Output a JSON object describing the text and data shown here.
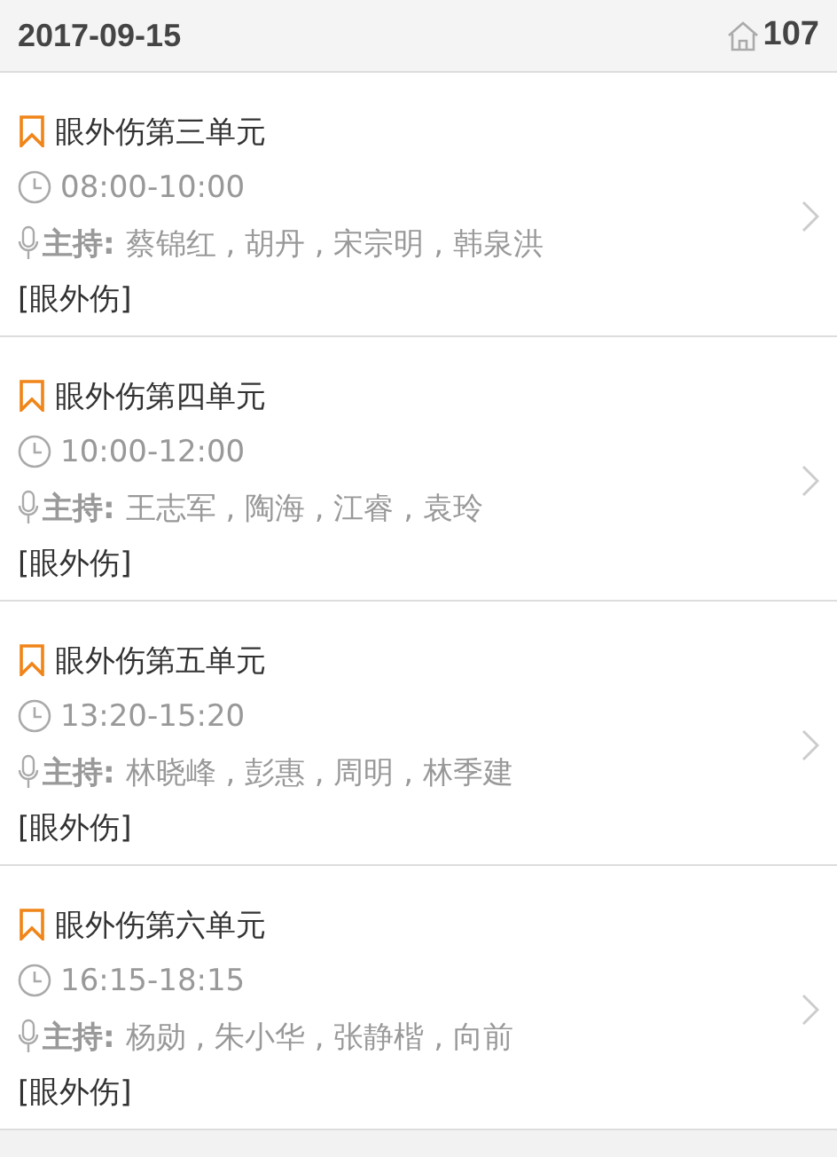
{
  "header": {
    "date": "2017-09-15",
    "room": "107"
  },
  "sessions": [
    {
      "title": "眼外伤第三单元",
      "time": "08:00-10:00",
      "host_label": "主持:",
      "hosts": "蔡锦红 , 胡丹 , 宋宗明 , 韩泉洪",
      "tag": "[眼外伤]"
    },
    {
      "title": "眼外伤第四单元",
      "time": "10:00-12:00",
      "host_label": "主持:",
      "hosts": "王志军 , 陶海 , 江睿 , 袁玲",
      "tag": "[眼外伤]"
    },
    {
      "title": "眼外伤第五单元",
      "time": "13:20-15:20",
      "host_label": "主持:",
      "hosts": "林晓峰 , 彭惠 , 周明 , 林季建",
      "tag": "[眼外伤]"
    },
    {
      "title": "眼外伤第六单元",
      "time": "16:15-18:15",
      "host_label": "主持:",
      "hosts": "杨勋 , 朱小华 , 张静楷 , 向前",
      "tag": "[眼外伤]"
    }
  ]
}
